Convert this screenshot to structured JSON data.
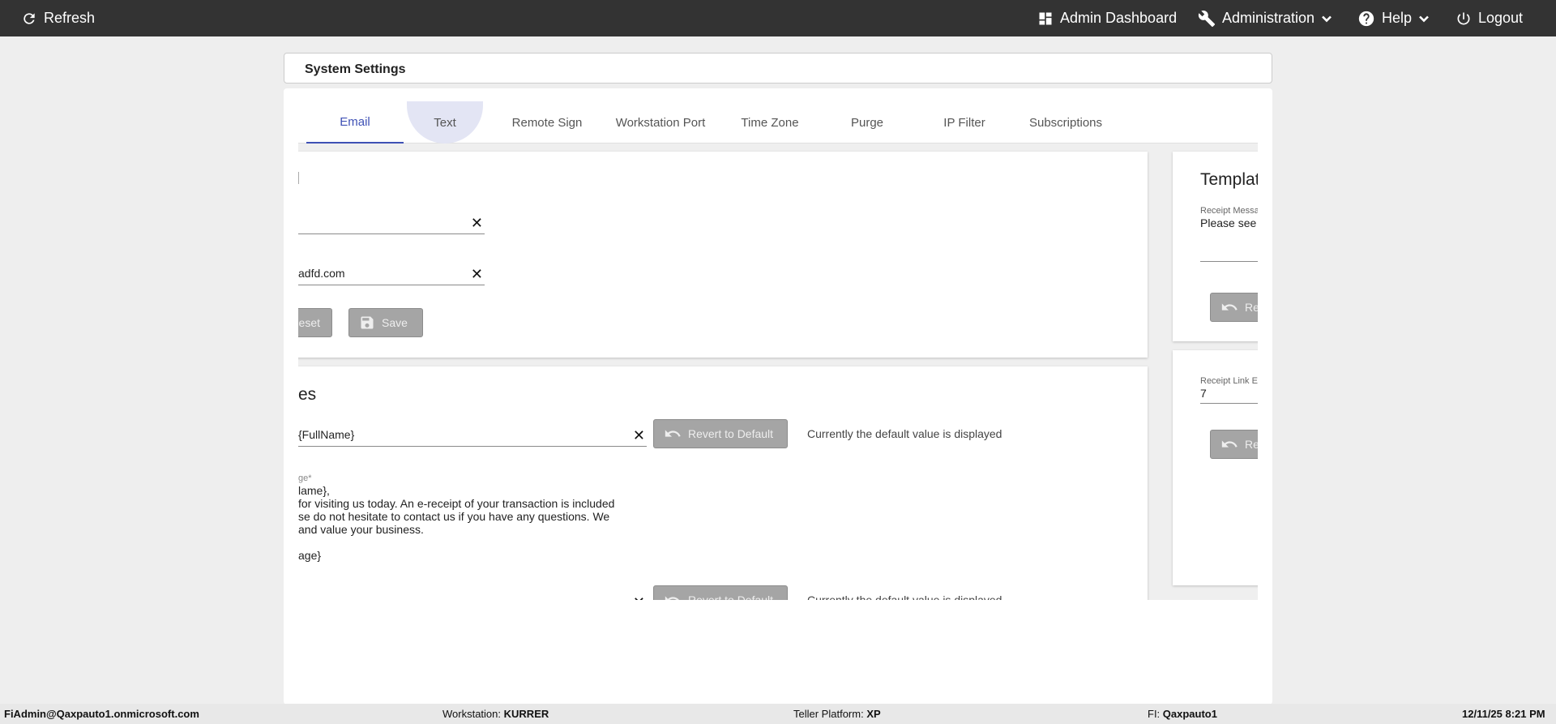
{
  "topbar": {
    "refresh": "Refresh",
    "admin_dashboard": "Admin Dashboard",
    "administration": "Administration",
    "help": "Help",
    "logout": "Logout"
  },
  "header": {
    "title": "System Settings"
  },
  "tabs": [
    {
      "label": "Email"
    },
    {
      "label": "Text"
    },
    {
      "label": "Remote Sign"
    },
    {
      "label": "Workstation Port"
    },
    {
      "label": "Time Zone"
    },
    {
      "label": "Purge"
    },
    {
      "label": "IP Filter"
    },
    {
      "label": "Subscriptions"
    }
  ],
  "email_card": {
    "field2_value": "adfd.com",
    "reset_label": "eset",
    "save_label": "Save"
  },
  "templates_card": {
    "title": "es",
    "field1_value": "{FullName}",
    "revert_label": "Revert to Default",
    "default_note": "Currently the default value is displayed",
    "body_label": "ge*",
    "body_lines": [
      "lame},",
      "for visiting us today. An e-receipt of your transaction is included",
      "se do not hesitate to contact us if you have any questions. We",
      "and value your business.",
      "",
      "age}"
    ],
    "revert_label_2": "Revert to Default",
    "default_note_2": "Currently the default value is displayed"
  },
  "right_top": {
    "title": "Templat",
    "label": "Receipt Messag",
    "value": "Please see",
    "button": "Re"
  },
  "right_bottom": {
    "label": "Receipt Link Ex",
    "value": "7",
    "button": "Re"
  },
  "footer": {
    "user": "FiAdmin@Qaxpauto1.onmicrosoft.com",
    "workstation_label": "Workstation:",
    "workstation_value": "KURRER",
    "platform_label": "Teller Platform:",
    "platform_value": "XP",
    "fi_label": "FI:",
    "fi_value": "Qaxpauto1",
    "datetime": "12/11/25 8:21 PM"
  }
}
